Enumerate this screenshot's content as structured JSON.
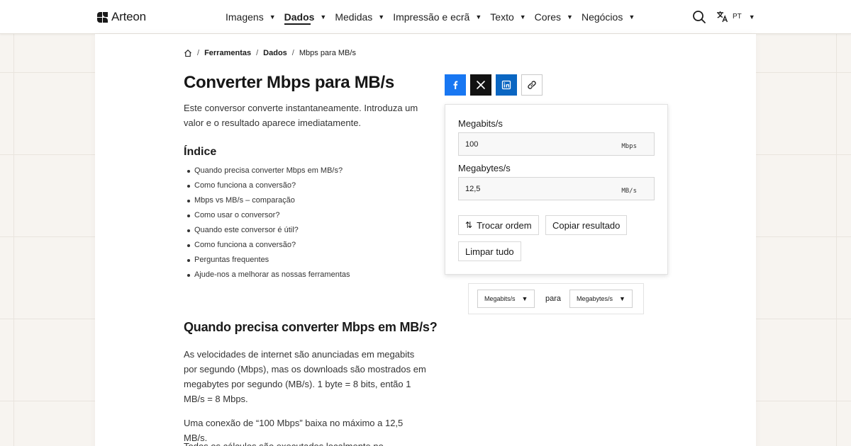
{
  "header": {
    "brand": "Arteon",
    "nav": [
      {
        "label": "Imagens",
        "active": false
      },
      {
        "label": "Dados",
        "active": true
      },
      {
        "label": "Medidas",
        "active": false
      },
      {
        "label": "Impressão e ecrã",
        "active": false
      },
      {
        "label": "Texto",
        "active": false
      },
      {
        "label": "Cores",
        "active": false
      },
      {
        "label": "Negócios",
        "active": false
      }
    ],
    "search_icon": "search-icon",
    "language": "PT",
    "language_icon": "translate-icon"
  },
  "breadcrumb": {
    "home_icon": "home-icon",
    "items": [
      "Ferramentas",
      "Dados",
      "Mbps para MB/s"
    ]
  },
  "page": {
    "title": "Converter Mbps para MB/s",
    "intro": "Este conversor converte instantaneamente. Introduza um valor e o resultado aparece imediatamente.",
    "toc_title": "Índice",
    "toc": [
      "Quando precisa converter Mbps em MB/s?",
      "Como funciona a conversão?",
      "Mbps vs MB/s – comparação",
      "Como usar o conversor?",
      "Quando este conversor é útil?",
      "Como funciona a conversão?",
      "Perguntas frequentes",
      "Ajude-nos a melhorar as nossas ferramentas"
    ],
    "section_title": "Quando precisa converter Mbps em MB/s?",
    "paragraphs": [
      "As velocidades de internet são anunciadas em megabits por segundo (Mbps), mas os downloads são mostrados em megabytes por segundo (MB/s). 1 byte = 8 bits, então 1 MB/s = 8 Mbps.",
      "Uma conexão de “100 Mbps” baixa no máximo a 12,5 MB/s.",
      "Todos os cálculos são executados localmente no"
    ]
  },
  "share": {
    "facebook_icon": "facebook-icon",
    "x_icon": "x-icon",
    "linkedin_icon": "linkedin-icon",
    "link_icon": "link-icon",
    "colors": {
      "facebook": "#1877f2",
      "x": "#121212",
      "linkedin": "#0a66c2"
    }
  },
  "converter": {
    "input_label": "Megabits/s",
    "input_value": "100",
    "input_unit": "Mbps",
    "output_label": "Megabytes/s",
    "output_value": "12,5",
    "output_unit": "MB/s",
    "swap_label": "Trocar ordem",
    "copy_label": "Copiar resultado",
    "clear_label": "Limpar tudo"
  },
  "unit_selector": {
    "from": "Megabits/s",
    "connector": "para",
    "to": "Megabytes/s"
  }
}
